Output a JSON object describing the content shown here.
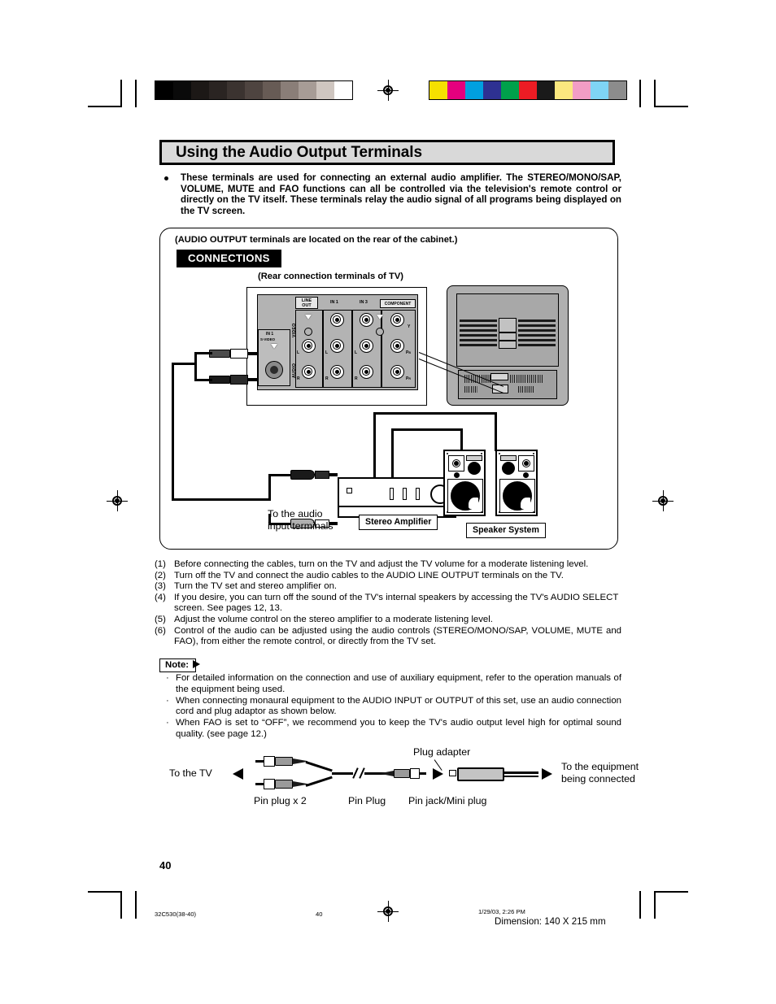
{
  "document": {
    "title": "Using the Audio Output Terminals",
    "intro": "These terminals are used for connecting an external audio amplifier. The STEREO/MONO/SAP, VOLUME, MUTE and FAO functions can all be controlled via the television's remote control or directly on the TV itself. These terminals relay the audio signal of all programs being displayed on the TV screen.",
    "page_number": "40"
  },
  "connections": {
    "location_note": "(AUDIO OUTPUT terminals are located on the rear of the cabinet.)",
    "badge": "CONNECTIONS",
    "rear_caption": "(Rear connection terminals of TV)",
    "terminal_panel": {
      "svideo_label_line1": "IN 1",
      "svideo_label_line2": "S-VIDEO",
      "column_headers": [
        "LINE OUT",
        "IN 1",
        "IN 3",
        "COMPONENT"
      ],
      "side_labels": [
        "VIDEO",
        "AUDIO"
      ],
      "component_labels": [
        "Y",
        "PB",
        "PR"
      ],
      "audio_labels": [
        "L",
        "R"
      ]
    },
    "captions": {
      "to_audio_input_line1": "To the audio",
      "to_audio_input_line2": "input terminals",
      "stereo_amplifier": "Stereo Amplifier",
      "speaker_system": "Speaker System"
    }
  },
  "steps": [
    {
      "num": "(1)",
      "text": "Before connecting the cables, turn on the TV and adjust the TV volume for a moderate listening level."
    },
    {
      "num": "(2)",
      "text": "Turn off the TV and connect the audio cables to the AUDIO LINE OUTPUT terminals on the TV."
    },
    {
      "num": "(3)",
      "text": "Turn the TV set and stereo amplifier on."
    },
    {
      "num": "(4)",
      "text": "If you desire, you can turn off the sound of the TV's internal speakers by accessing the TV's AUDIO SELECT screen. See pages 12, 13."
    },
    {
      "num": "(5)",
      "text": "Adjust the volume control on the stereo amplifier to a moderate listening level."
    },
    {
      "num": "(6)",
      "text": "Control of the audio can be adjusted using the audio controls (STEREO/MONO/SAP, VOLUME, MUTE and FAO), from either the remote control, or directly from the TV set."
    }
  ],
  "note": {
    "label": "Note:",
    "items": [
      "For detailed information on the connection and use of auxiliary equipment, refer to the operation manuals of the equipment being used.",
      "When connecting monaural equipment to the AUDIO INPUT or OUTPUT of this set, use an audio connection cord and plug adaptor as shown below.",
      "When FAO is set to “OFF”, we recommend you to keep the TV's audio output level high for optimal sound quality. (see page 12.)"
    ]
  },
  "adapter_diagram": {
    "to_the_tv": "To the TV",
    "pin_plug_x2": "Pin plug x 2",
    "pin_plug": "Pin Plug",
    "plug_adapter": "Plug adapter",
    "pin_jack_mini_plug": "Pin jack/Mini plug",
    "to_equipment_line1": "To the equipment",
    "to_equipment_line2": "being connected"
  },
  "footer": {
    "file_ref": "32C530(38-40)",
    "page": "40",
    "timestamp": "1/29/03, 2:26 PM",
    "dimension": "Dimension: 140  X 215 mm"
  },
  "calibration": {
    "grayscale": [
      "#000000",
      "#0a0a0a",
      "#1c1816",
      "#2a2422",
      "#3b3330",
      "#4e4440",
      "#675b55",
      "#8a7e78",
      "#a79c96",
      "#cfc6c0",
      "#ffffff"
    ],
    "colors": [
      "#f5e000",
      "#e5007e",
      "#00a0e0",
      "#2e3192",
      "#00a14b",
      "#ed1c24",
      "#1a1a1a",
      "#fbe87f",
      "#f29dc5",
      "#7fd4f5",
      "#8c8c8c"
    ]
  }
}
